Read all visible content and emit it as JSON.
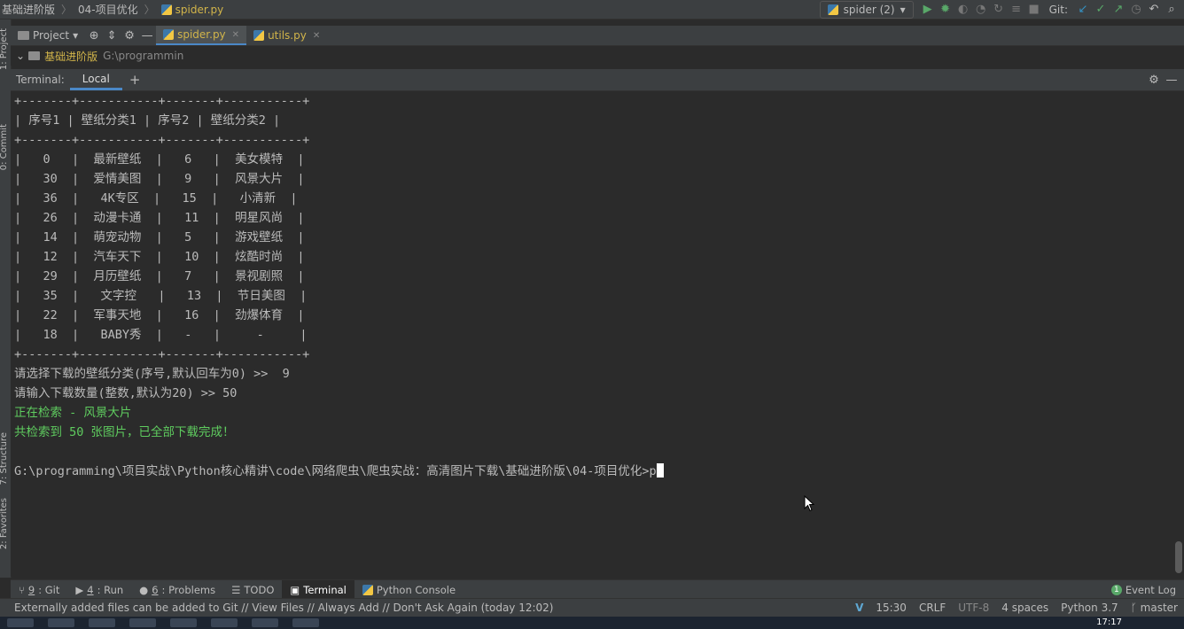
{
  "navbar": {
    "crumbs": [
      "基础进阶版",
      "04-项目优化",
      "spider.py"
    ],
    "run_config": "spider (2)",
    "git_label": "Git:"
  },
  "project_panel": {
    "title": "Project",
    "tabs": [
      {
        "label": "spider.py"
      },
      {
        "label": "utils.py"
      }
    ],
    "tree_root": "基础进阶版",
    "tree_path": "G:\\programmin"
  },
  "left_strip": {
    "project": "1: Project",
    "commit": "0: Commit",
    "structure": "7: Structure",
    "favorites": "2: Favorites"
  },
  "terminal": {
    "header_label": "Terminal:",
    "tab_local": "Local",
    "add_label": "+",
    "lines": [
      "+-------+-----------+-------+-----------+",
      "| 序号1 | 壁纸分类1 | 序号2 | 壁纸分类2 |",
      "+-------+-----------+-------+-----------+",
      "|   0   |  最新壁纸  |   6   |  美女模特  |",
      "|   30  |  爱情美图  |   9   |  风景大片  |",
      "|   36  |   4K专区  |   15  |   小清新  |",
      "|   26  |  动漫卡通  |   11  |  明星风尚  |",
      "|   14  |  萌宠动物  |   5   |  游戏壁纸  |",
      "|   12  |  汽车天下  |   10  |  炫酷时尚  |",
      "|   29  |  月历壁纸  |   7   |  景视剧照  |",
      "|   35  |   文字控   |   13  |  节日美图  |",
      "|   22  |  军事天地  |   16  |  劲爆体育  |",
      "|   18  |   BABY秀  |   -   |     -     |",
      "+-------+-----------+-------+-----------+",
      "请选择下载的壁纸分类(序号,默认回车为0) >>  9",
      "请输入下载数量(整数,默认为20) >> 50"
    ],
    "green_lines": [
      "正在检索 - 风景大片",
      "共检索到 50 张图片，已全部下载完成！"
    ],
    "prompt": "G:\\programming\\项目实战\\Python核心精讲\\code\\网络爬虫\\爬虫实战：高清图片下载\\基础进阶版\\04-项目优化>",
    "typed": "p"
  },
  "tool_windows": [
    {
      "num": "9",
      "label": ": Git"
    },
    {
      "num": "4",
      "label": ": Run"
    },
    {
      "num": "6",
      "label": ": Problems"
    },
    {
      "num": "",
      "label": "TODO"
    },
    {
      "num": "",
      "label": "Terminal"
    },
    {
      "num": "",
      "label": "Python Console"
    }
  ],
  "event_log": "Event Log",
  "event_count": "1",
  "status": {
    "message": "Externally added files can be added to Git // View Files // Always Add // Don't Ask Again (today 12:02)",
    "position": "15:30",
    "line_sep": "CRLF",
    "encoding": "UTF-8",
    "indent": "4 spaces",
    "interpreter": "Python 3.7",
    "branch": "master"
  },
  "taskbar": {
    "clock": "17:17"
  },
  "colors": {
    "accent": "#4a88c7",
    "success": "#5fcc5f",
    "folder_label": "#d1b44a"
  }
}
